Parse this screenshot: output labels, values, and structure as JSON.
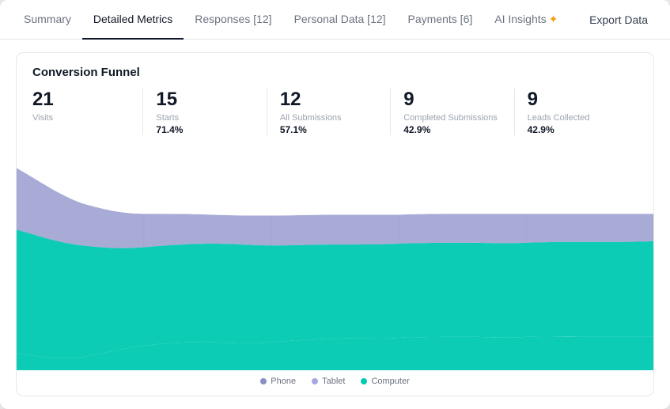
{
  "tabs": [
    {
      "id": "summary",
      "label": "Summary",
      "active": false
    },
    {
      "id": "detailed-metrics",
      "label": "Detailed Metrics",
      "active": true
    },
    {
      "id": "responses",
      "label": "Responses [12]",
      "active": false
    },
    {
      "id": "personal-data",
      "label": "Personal Data [12]",
      "active": false
    },
    {
      "id": "payments",
      "label": "Payments [6]",
      "active": false
    },
    {
      "id": "ai-insights",
      "label": "AI Insights",
      "active": false
    }
  ],
  "export_label": "Export Data",
  "card_title": "Conversion Funnel",
  "metrics": [
    {
      "value": "21",
      "label": "Visits",
      "pct": ""
    },
    {
      "value": "15",
      "label": "Starts",
      "pct": "71.4%"
    },
    {
      "value": "12",
      "label": "All Submissions",
      "pct": "57.1%"
    },
    {
      "value": "9",
      "label": "Completed Submissions",
      "pct": "42.9%"
    },
    {
      "value": "9",
      "label": "Leads Collected",
      "pct": "42.9%"
    }
  ],
  "legend": [
    {
      "label": "Phone",
      "color": "#8b8fc7"
    },
    {
      "label": "Tablet",
      "color": "#a5a8e0"
    },
    {
      "label": "Computer",
      "color": "#00c9b1"
    }
  ],
  "colors": {
    "teal": "#00c9b1",
    "purple": "#8b8fc7",
    "light_purple": "#b0b3e8"
  }
}
